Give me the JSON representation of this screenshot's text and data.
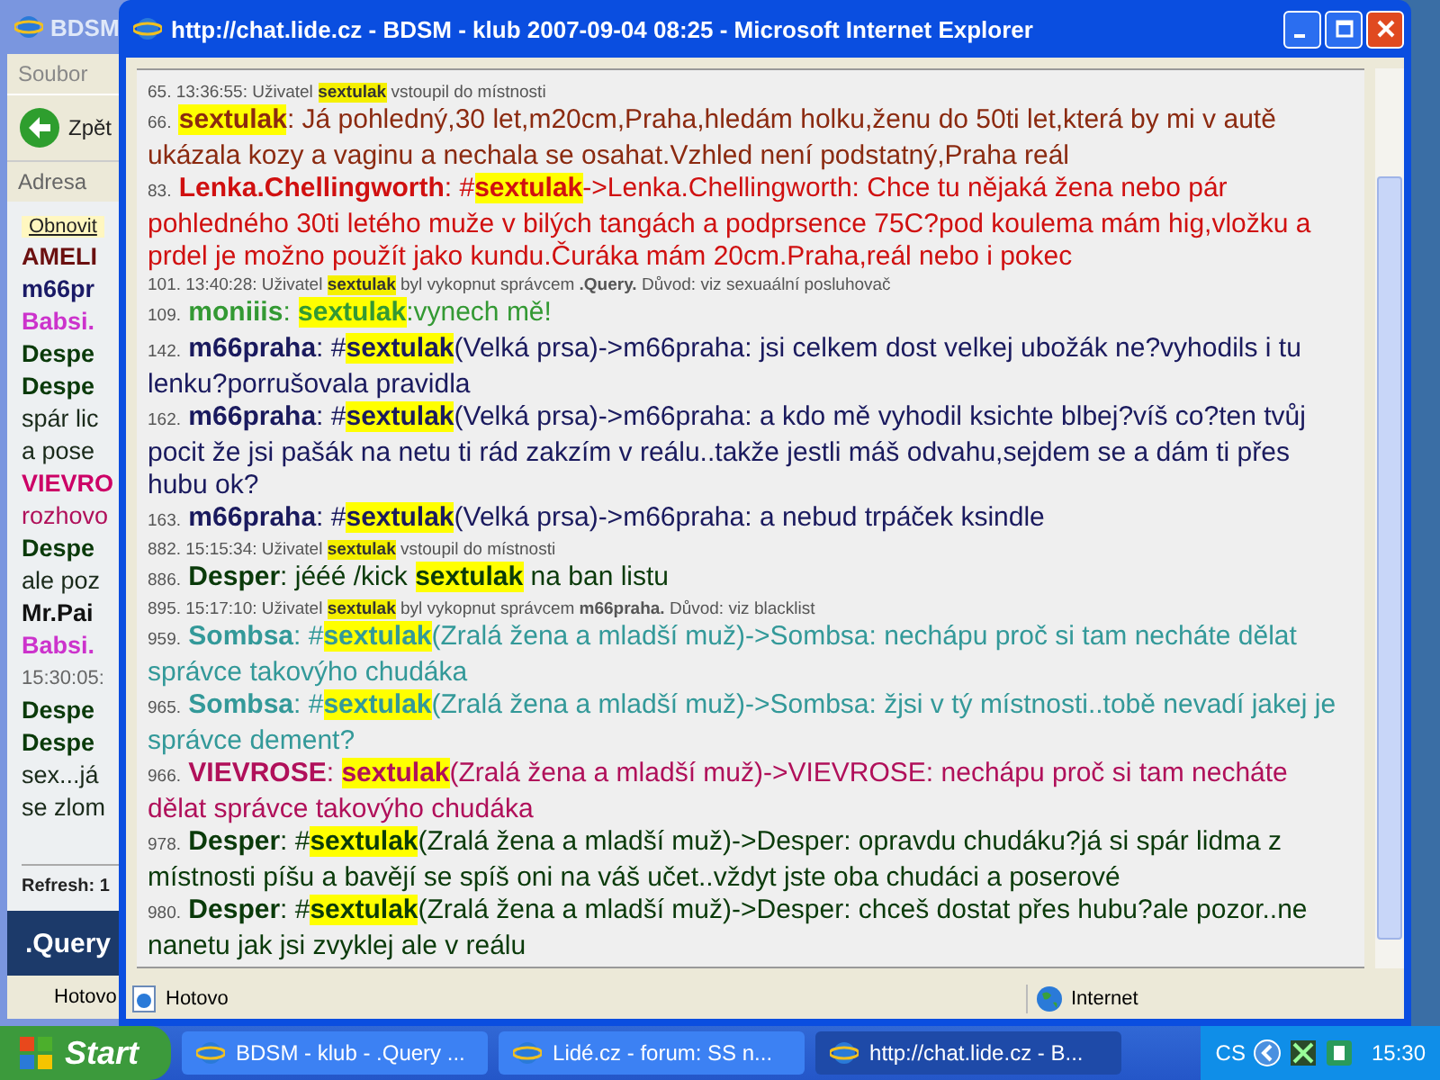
{
  "background_window": {
    "title": "BDSM",
    "menu": "Soubor",
    "back_button": "Zpět",
    "address_label": "Adresa",
    "refresh_button": "Obnovit",
    "lines": [
      {
        "text": "AMELI",
        "color": "#6b1010",
        "kind": "name"
      },
      {
        "text": "m66pr",
        "color": "#1a1a66",
        "kind": "name"
      },
      {
        "text": "Babsi.",
        "color": "#cc33cc",
        "kind": "name"
      },
      {
        "text": "Despe",
        "color": "#0a3a0a",
        "kind": "name"
      },
      {
        "text": "Despe",
        "color": "#0a3a0a",
        "kind": "name"
      },
      {
        "text": "spár lic",
        "color": "#1a2a1a",
        "kind": "text"
      },
      {
        "text": "a pose",
        "color": "#1a2a1a",
        "kind": "text"
      },
      {
        "text": "VIEVRO",
        "color": "#cc0066",
        "kind": "name"
      },
      {
        "text": "rozhovo",
        "color": "#b0105a",
        "kind": "text"
      },
      {
        "text": "Despe",
        "color": "#0a3a0a",
        "kind": "name"
      },
      {
        "text": "ale poz",
        "color": "#1a2a1a",
        "kind": "text"
      },
      {
        "text": "Mr.Pai",
        "color": "#111111",
        "kind": "name"
      },
      {
        "text": "Babsi.",
        "color": "#cc33cc",
        "kind": "name"
      },
      {
        "text": "15:30:05:",
        "color": "#666666",
        "kind": "time"
      },
      {
        "text": "Despe",
        "color": "#0a3a0a",
        "kind": "name"
      },
      {
        "text": "Despe",
        "color": "#0a3a0a",
        "kind": "name"
      },
      {
        "text": "sex...já",
        "color": "#1a2a1a",
        "kind": "text"
      },
      {
        "text": "se zlom",
        "color": "#1a2a1a",
        "kind": "text"
      }
    ],
    "refresh_text": "Refresh: 1",
    "footer": ".Query",
    "status": "Hotovo"
  },
  "window": {
    "title": "http://chat.lide.cz - BDSM - klub 2007-09-04 08:25 - Microsoft Internet Explorer"
  },
  "chat": [
    {
      "kind": "system",
      "number": "65.",
      "time": "13:36:55:",
      "parts": [
        {
          "text": "Uživatel ",
          "kind": "text"
        },
        {
          "text": "sextulak",
          "kind": "highlight"
        },
        {
          "text": " vstoupil do místnosti",
          "kind": "text"
        }
      ]
    },
    {
      "kind": "message",
      "number": "66.",
      "color": "#8b2a10",
      "parts": [
        {
          "text": "sextulak",
          "kind": "highlight"
        },
        {
          "text": ": Já pohledný,30 let,m20cm,Praha,hledám holku,ženu do 50ti let,která by mi v autě ukázala kozy a vaginu a nechala se osahat.Vzhled není podstatný,Praha reál",
          "kind": "text"
        }
      ]
    },
    {
      "kind": "message",
      "number": "83.",
      "color": "#d01010",
      "parts": [
        {
          "text": "Lenka.Chellingworth",
          "kind": "author"
        },
        {
          "text": ": #",
          "kind": "text"
        },
        {
          "text": "sextulak",
          "kind": "highlight"
        },
        {
          "text": "->Lenka.Chellingworth: Chce tu nějaká žena nebo pár pohledného 30ti letého muže v bilých tangách a podprsence 75C?pod koulema mám hig,vložku a prdel je možno použít jako kundu.Čuráka mám 20cm.Praha,reál nebo i pokec",
          "kind": "text"
        }
      ]
    },
    {
      "kind": "system",
      "number": "101.",
      "time": "13:40:28:",
      "parts": [
        {
          "text": "Uživatel ",
          "kind": "text"
        },
        {
          "text": "sextulak",
          "kind": "highlight"
        },
        {
          "text": " byl vykopnut správcem ",
          "kind": "text"
        },
        {
          "text": ".Query.",
          "kind": "author"
        },
        {
          "text": " Důvod: viz sexuaální posluhovač",
          "kind": "text"
        }
      ]
    },
    {
      "kind": "message",
      "number": "109.",
      "color": "#339933",
      "parts": [
        {
          "text": "moniiis",
          "kind": "author"
        },
        {
          "text": ": ",
          "kind": "text"
        },
        {
          "text": "sextulak",
          "kind": "highlight"
        },
        {
          "text": ":vynech mě!",
          "kind": "text"
        }
      ]
    },
    {
      "kind": "message",
      "number": "142.",
      "color": "#1a1a5e",
      "parts": [
        {
          "text": "m66praha",
          "kind": "author"
        },
        {
          "text": ": #",
          "kind": "text"
        },
        {
          "text": "sextulak",
          "kind": "highlight"
        },
        {
          "text": "(Velká prsa)->m66praha: jsi celkem dost velkej ubožák ne?vyhodils i tu lenku?porrušovala pravidla",
          "kind": "text"
        }
      ]
    },
    {
      "kind": "message",
      "number": "162.",
      "color": "#1a1a5e",
      "parts": [
        {
          "text": "m66praha",
          "kind": "author"
        },
        {
          "text": ": #",
          "kind": "text"
        },
        {
          "text": "sextulak",
          "kind": "highlight"
        },
        {
          "text": "(Velká prsa)->m66praha: a kdo mě vyhodil ksichte blbej?víš co?ten tvůj pocit že jsi pašák na netu ti rád zakzím v reálu..takže jestli máš odvahu,sejdem se a dám ti přes hubu ok?",
          "kind": "text"
        }
      ]
    },
    {
      "kind": "message",
      "number": "163.",
      "color": "#1a1a5e",
      "parts": [
        {
          "text": "m66praha",
          "kind": "author"
        },
        {
          "text": ": #",
          "kind": "text"
        },
        {
          "text": "sextulak",
          "kind": "highlight"
        },
        {
          "text": "(Velká prsa)->m66praha: a nebud trpáček ksindle",
          "kind": "text"
        }
      ]
    },
    {
      "kind": "system",
      "number": "882.",
      "time": "15:15:34:",
      "parts": [
        {
          "text": "Uživatel ",
          "kind": "text"
        },
        {
          "text": "sextulak",
          "kind": "highlight"
        },
        {
          "text": " vstoupil do místnosti",
          "kind": "text"
        }
      ]
    },
    {
      "kind": "message",
      "number": "886.",
      "color": "#0a3a0a",
      "parts": [
        {
          "text": "Desper",
          "kind": "author"
        },
        {
          "text": ": jééé /kick ",
          "kind": "text"
        },
        {
          "text": "sextulak",
          "kind": "highlight"
        },
        {
          "text": " na ban listu",
          "kind": "text"
        }
      ]
    },
    {
      "kind": "system",
      "number": "895.",
      "time": "15:17:10:",
      "parts": [
        {
          "text": "Uživatel ",
          "kind": "text"
        },
        {
          "text": "sextulak",
          "kind": "highlight"
        },
        {
          "text": " byl vykopnut správcem ",
          "kind": "text"
        },
        {
          "text": "m66praha.",
          "kind": "author"
        },
        {
          "text": " Důvod: viz blacklist",
          "kind": "text"
        }
      ]
    },
    {
      "kind": "message",
      "number": "959.",
      "color": "#339999",
      "parts": [
        {
          "text": "Sombsa",
          "kind": "author"
        },
        {
          "text": ": #",
          "kind": "text"
        },
        {
          "text": "sextulak",
          "kind": "highlight"
        },
        {
          "text": "(Zralá žena a mladší muž)->Sombsa: nechápu proč si tam necháte dělat správce takovýho chudáka",
          "kind": "text"
        }
      ]
    },
    {
      "kind": "message",
      "number": "965.",
      "color": "#339999",
      "parts": [
        {
          "text": "Sombsa",
          "kind": "author"
        },
        {
          "text": ": #",
          "kind": "text"
        },
        {
          "text": "sextulak",
          "kind": "highlight"
        },
        {
          "text": "(Zralá žena a mladší muž)->Sombsa: žjsi v tý místnosti..tobě nevadí jakej je správce dement?",
          "kind": "text"
        }
      ]
    },
    {
      "kind": "message",
      "number": "966.",
      "color": "#b0105a",
      "parts": [
        {
          "text": "VIEVROSE",
          "kind": "author"
        },
        {
          "text": ": ",
          "kind": "text"
        },
        {
          "text": "sextulak",
          "kind": "highlight"
        },
        {
          "text": "(Zralá žena a mladší muž)->VIEVROSE: nechápu proč si tam necháte dělat správce takovýho chudáka",
          "kind": "text"
        }
      ]
    },
    {
      "kind": "message",
      "number": "978.",
      "color": "#0a3a0a",
      "parts": [
        {
          "text": "Desper",
          "kind": "author"
        },
        {
          "text": ": #",
          "kind": "text"
        },
        {
          "text": "sextulak",
          "kind": "highlight"
        },
        {
          "text": "(Zralá žena a mladší muž)->Desper: opravdu chudáku?já si spár lidma z místnosti píšu a bavějí se spíš oni na váš učet..vždyt jste oba chudáci a poserové",
          "kind": "text"
        }
      ]
    },
    {
      "kind": "message",
      "number": "980.",
      "color": "#0a3a0a",
      "parts": [
        {
          "text": "Desper",
          "kind": "author"
        },
        {
          "text": ": #",
          "kind": "text"
        },
        {
          "text": "sextulak",
          "kind": "highlight"
        },
        {
          "text": "(Zralá žena a mladší muž)->Desper: chceš dostat přes hubu?ale pozor..ne nanetu jak jsi zvyklej ale v reálu",
          "kind": "text"
        }
      ]
    }
  ],
  "status_bar": {
    "status": "Hotovo",
    "zone": "Internet"
  },
  "taskbar": {
    "start": "Start",
    "tasks": [
      {
        "label": "BDSM - klub - .Query ...",
        "selected": false
      },
      {
        "label": "Lidé.cz - forum: SS n...",
        "selected": false
      },
      {
        "label": "http://chat.lide.cz - B...",
        "selected": true
      }
    ],
    "language": "CS",
    "clock": "15:30"
  }
}
